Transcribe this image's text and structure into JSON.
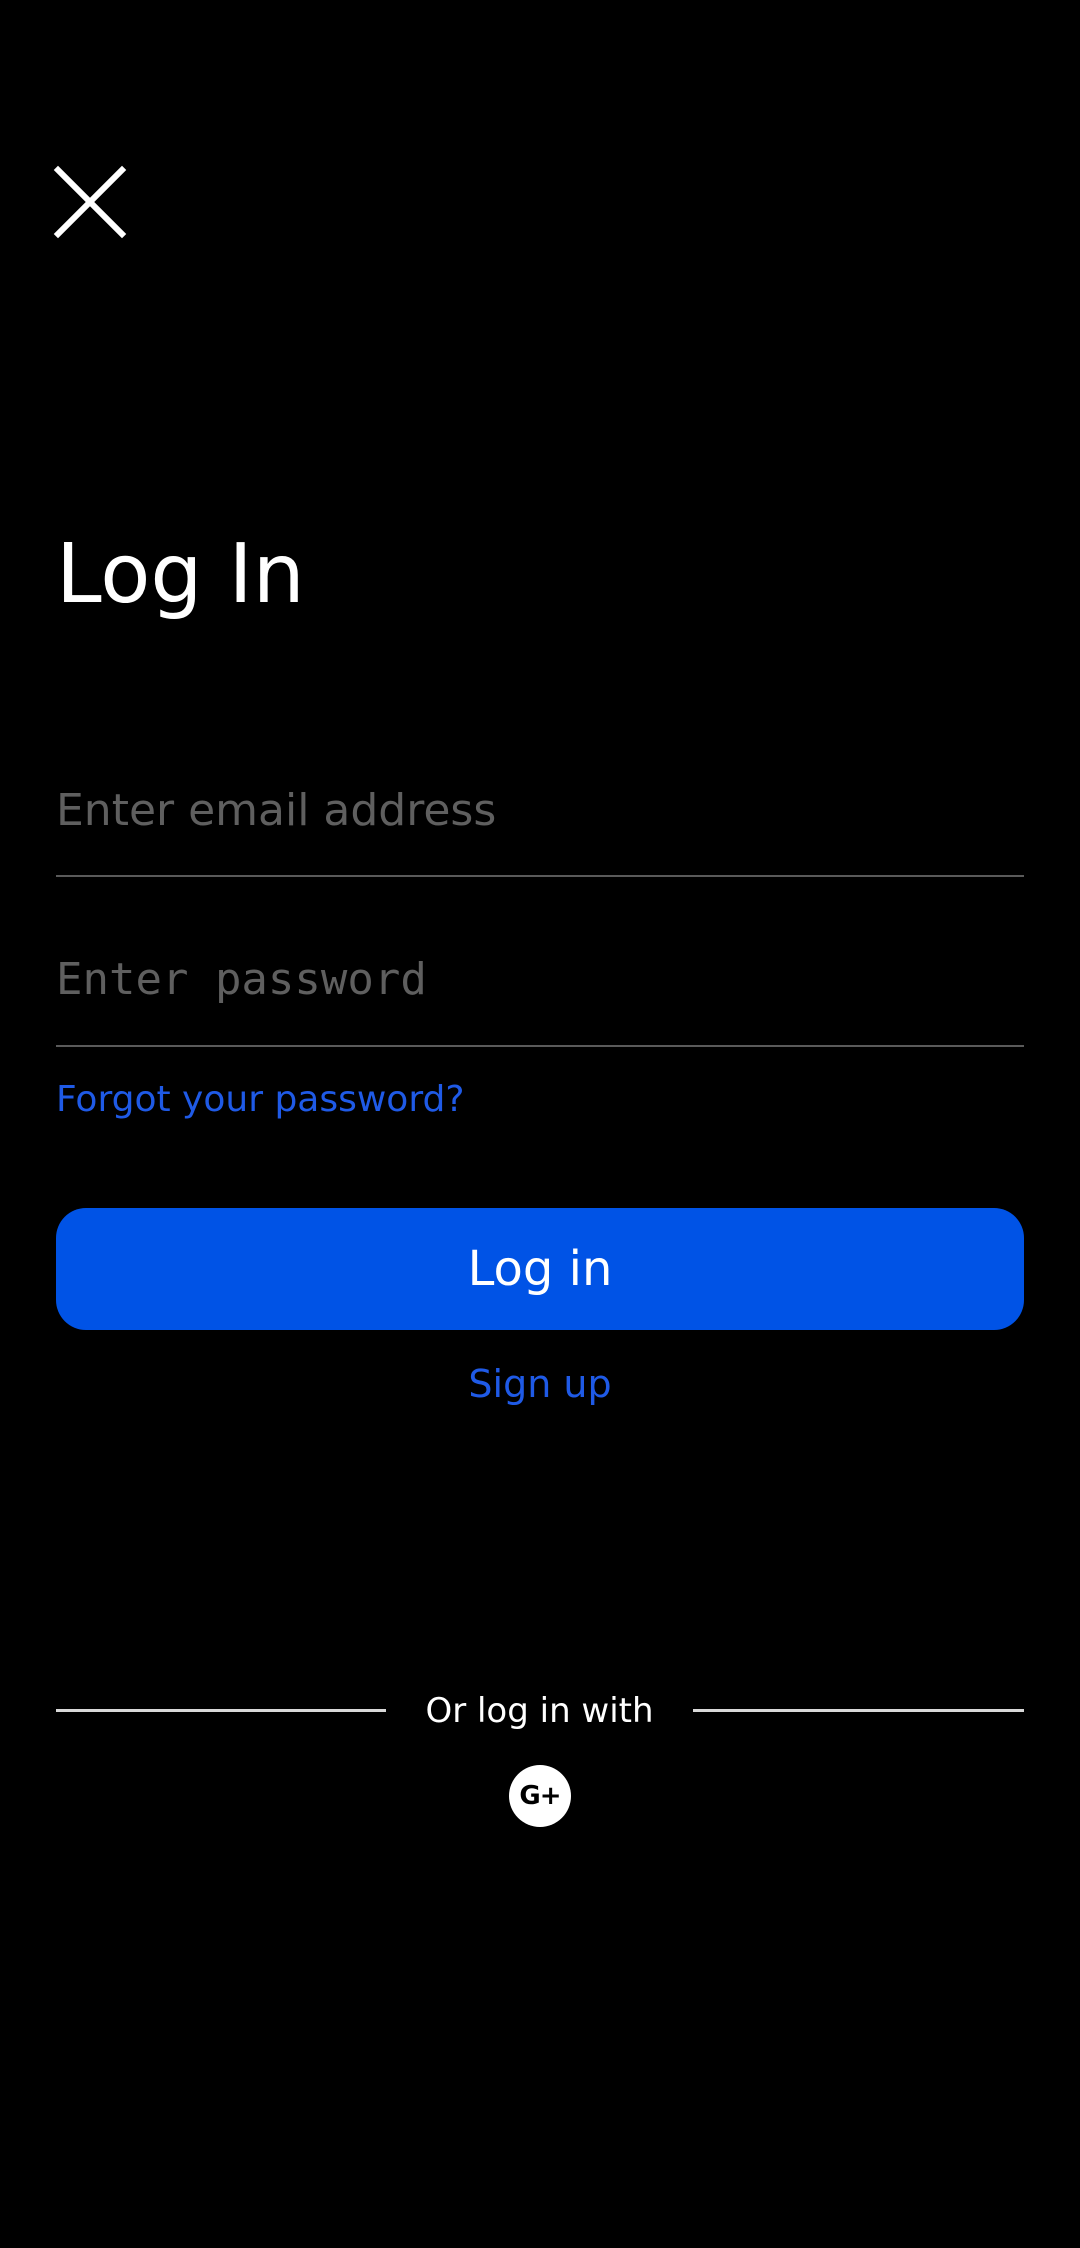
{
  "header": {
    "close_icon": "close-icon",
    "title": "Log In"
  },
  "form": {
    "email_placeholder": "Enter email address",
    "email_value": "",
    "password_placeholder": "Enter password",
    "password_value": "",
    "forgot_label": "Forgot your password?",
    "login_label": "Log in",
    "signup_label": "Sign up"
  },
  "social": {
    "divider_text": "Or log in with",
    "google_label": "G+",
    "google_icon": "google-plus-icon"
  },
  "colors": {
    "background": "#000000",
    "primary": "#0053e6",
    "link": "#1f5ae6",
    "placeholder": "#5f5f5f",
    "divider": "#d8d8d8"
  }
}
